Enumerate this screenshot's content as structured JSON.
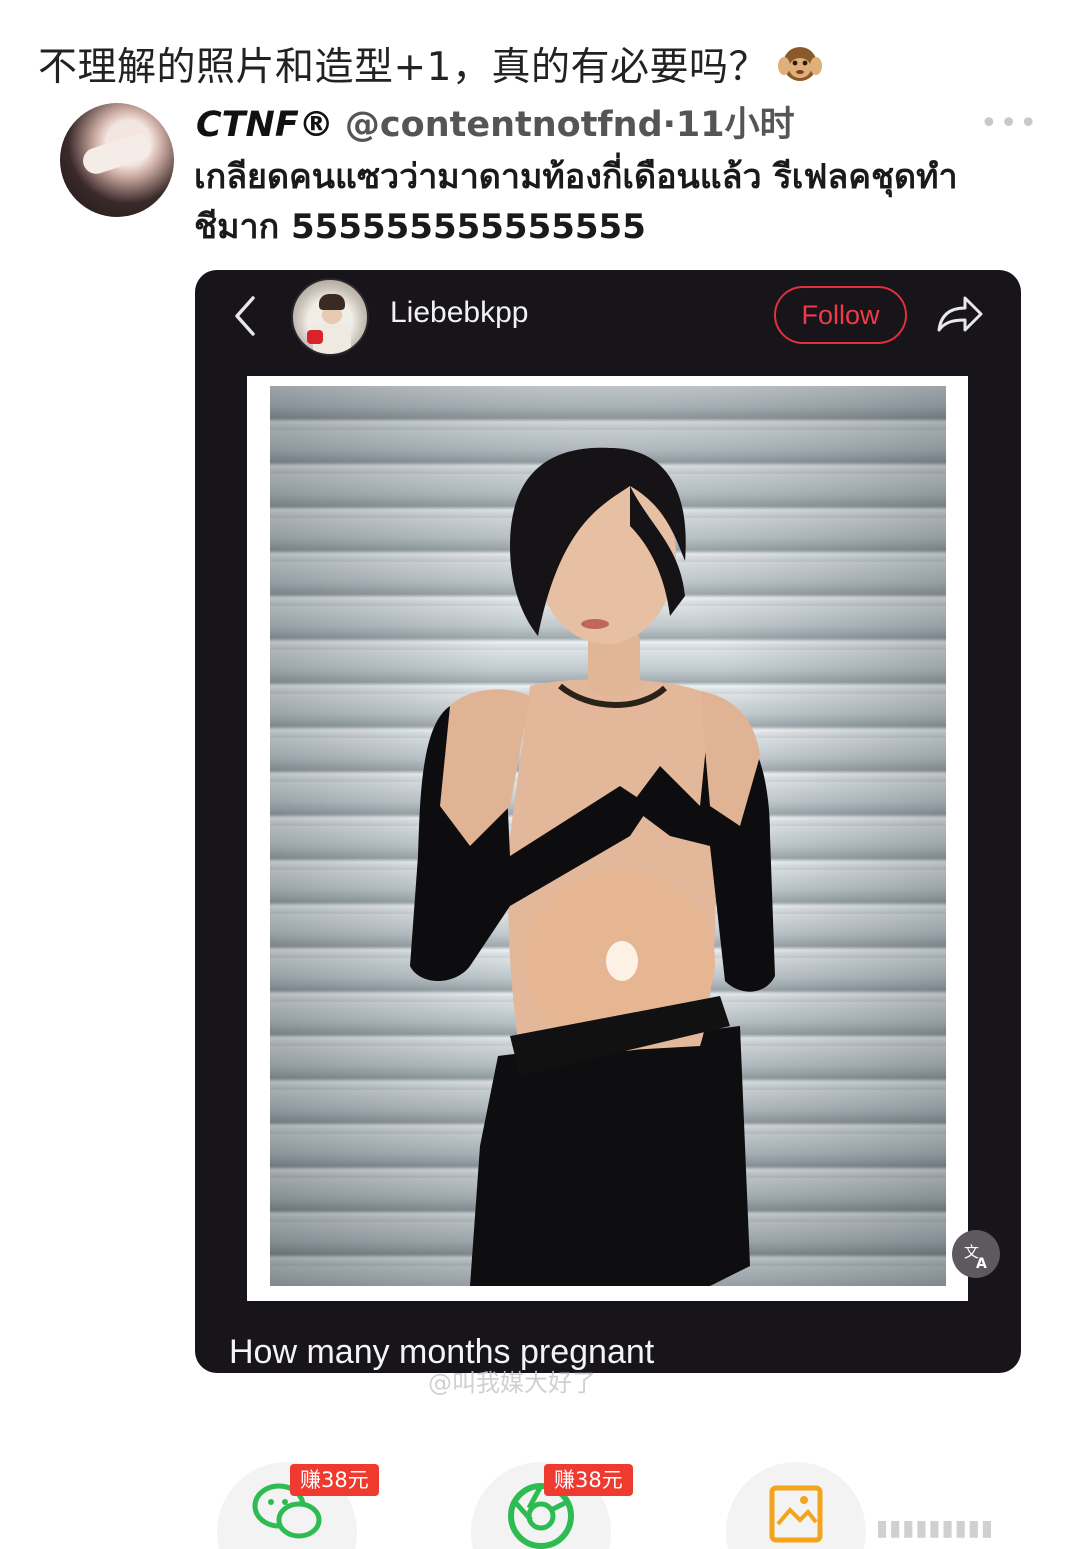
{
  "caption": {
    "text": "不理解的照片和造型+1，真的有必要吗？",
    "emoji": "🙉"
  },
  "tweet": {
    "display_name": "CTNF®",
    "handle": "@contentnotfnd",
    "separator": "·",
    "time": "11小时",
    "text_line1": "เกลียดคนแซวว่ามาดามท้องกี่เดือนแล้ว รีเฟลคชุดทำ",
    "text_line2": "ชีมาก 555555555555555"
  },
  "embed": {
    "username": "Liebebkpp",
    "follow_label": "Follow",
    "caption": "How many months pregnant",
    "watermark": "@叫我媒大好了"
  },
  "share_bar": {
    "items": [
      {
        "icon": "wechat-icon",
        "badge": "赚38元",
        "color": "#2dbb52"
      },
      {
        "icon": "moments-icon",
        "badge": "赚38元",
        "color": "#2dbb52"
      },
      {
        "icon": "save-image-icon",
        "color": "#f2a41c"
      }
    ]
  },
  "colors": {
    "follow": "#e0303d",
    "badge": "#ef3a30",
    "card_bg": "#17141a"
  }
}
